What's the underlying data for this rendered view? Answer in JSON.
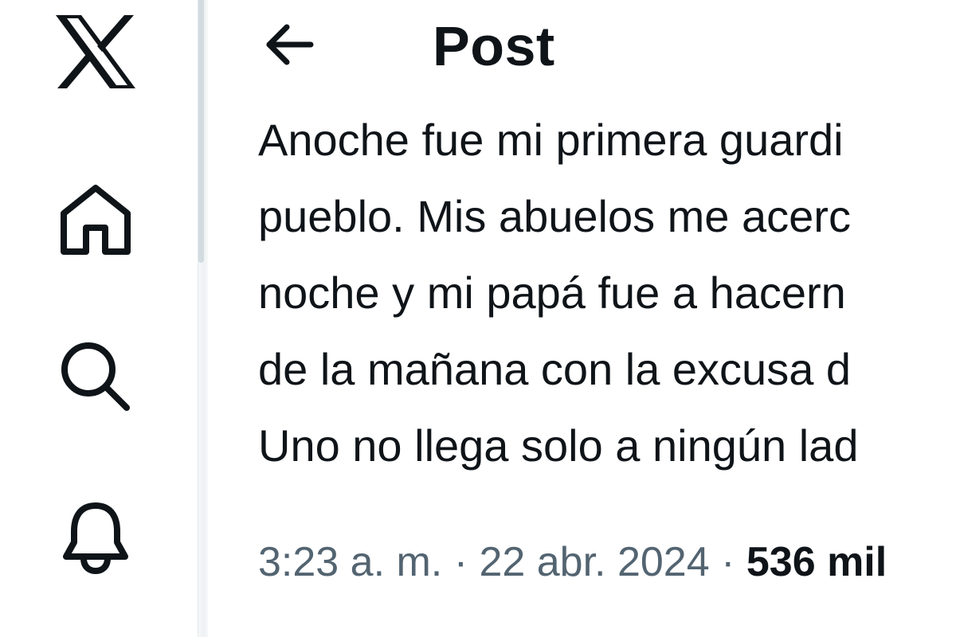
{
  "nav": {
    "items": [
      {
        "name": "x-logo",
        "icon": "x-logo-icon"
      },
      {
        "name": "home",
        "icon": "home-icon"
      },
      {
        "name": "search",
        "icon": "search-icon"
      },
      {
        "name": "notifications",
        "icon": "bell-icon"
      }
    ]
  },
  "header": {
    "back_icon": "arrow-left-icon",
    "title": "Post"
  },
  "post": {
    "lines": [
      "Anoche fue mi primera guardi",
      "pueblo. Mis abuelos me acerc",
      "noche y mi papá fue a hacern",
      "de la mañana con la excusa d",
      "Uno no llega solo a ningún lad"
    ],
    "time": "3:23 a. m.",
    "separator": "·",
    "date": "22 abr. 2024",
    "views": "536 mil"
  },
  "colors": {
    "text_primary": "#0f1419",
    "text_secondary": "#536471",
    "background": "#ffffff"
  }
}
